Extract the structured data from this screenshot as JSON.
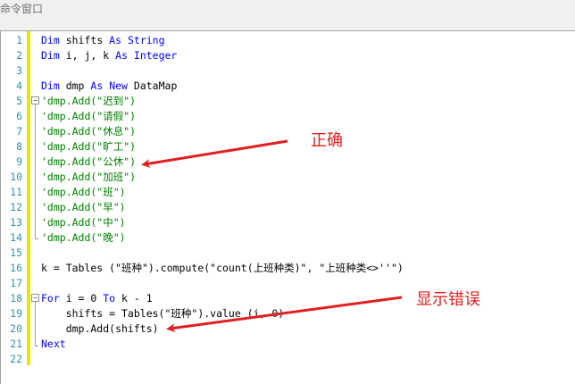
{
  "window": {
    "title": "命令窗口"
  },
  "code": {
    "lines": [
      {
        "num": "1",
        "segments": [
          {
            "t": "Dim",
            "c": "kw"
          },
          {
            "t": " shifts ",
            "c": ""
          },
          {
            "t": "As",
            "c": "kw"
          },
          {
            "t": " ",
            "c": ""
          },
          {
            "t": "String",
            "c": "kw"
          }
        ]
      },
      {
        "num": "2",
        "segments": [
          {
            "t": "Dim",
            "c": "kw"
          },
          {
            "t": " i, j, k ",
            "c": ""
          },
          {
            "t": "As",
            "c": "kw"
          },
          {
            "t": " ",
            "c": ""
          },
          {
            "t": "Integer",
            "c": "kw"
          }
        ]
      },
      {
        "num": "3",
        "segments": []
      },
      {
        "num": "4",
        "segments": [
          {
            "t": "Dim",
            "c": "kw"
          },
          {
            "t": " dmp ",
            "c": ""
          },
          {
            "t": "As",
            "c": "kw"
          },
          {
            "t": " ",
            "c": ""
          },
          {
            "t": "New",
            "c": "kw"
          },
          {
            "t": " DataMap",
            "c": ""
          }
        ]
      },
      {
        "num": "5",
        "segments": [
          {
            "t": "'dmp.Add(\"迟到\")",
            "c": "cm"
          }
        ]
      },
      {
        "num": "6",
        "segments": [
          {
            "t": "'dmp.Add(\"请假\")",
            "c": "cm"
          }
        ]
      },
      {
        "num": "7",
        "segments": [
          {
            "t": "'dmp.Add(\"休息\")",
            "c": "cm"
          }
        ]
      },
      {
        "num": "8",
        "segments": [
          {
            "t": "'dmp.Add(\"旷工\")",
            "c": "cm"
          }
        ]
      },
      {
        "num": "9",
        "segments": [
          {
            "t": "'dmp.Add(\"公休\")",
            "c": "cm"
          }
        ]
      },
      {
        "num": "10",
        "segments": [
          {
            "t": "'dmp.Add(\"加班\")",
            "c": "cm"
          }
        ]
      },
      {
        "num": "11",
        "segments": [
          {
            "t": "'dmp.Add(\"班\")",
            "c": "cm"
          }
        ]
      },
      {
        "num": "12",
        "segments": [
          {
            "t": "'dmp.Add(\"早\")",
            "c": "cm"
          }
        ]
      },
      {
        "num": "13",
        "segments": [
          {
            "t": "'dmp.Add(\"中\")",
            "c": "cm"
          }
        ]
      },
      {
        "num": "14",
        "segments": [
          {
            "t": "'dmp.Add(\"晚\")",
            "c": "cm"
          }
        ]
      },
      {
        "num": "15",
        "segments": []
      },
      {
        "num": "16",
        "segments": [
          {
            "t": "k = Tables (\"班种\").compute(\"count(上班种类)\", \"上班种类<>''\")",
            "c": ""
          }
        ]
      },
      {
        "num": "17",
        "segments": []
      },
      {
        "num": "18",
        "segments": [
          {
            "t": "For",
            "c": "kw"
          },
          {
            "t": " i = 0 ",
            "c": ""
          },
          {
            "t": "To",
            "c": "kw"
          },
          {
            "t": " k - 1",
            "c": ""
          }
        ]
      },
      {
        "num": "19",
        "segments": [
          {
            "t": "    shifts = Tables(\"班种\").value (i, 0)",
            "c": ""
          }
        ]
      },
      {
        "num": "20",
        "segments": [
          {
            "t": "    dmp.Add(shifts)",
            "c": ""
          }
        ]
      },
      {
        "num": "21",
        "segments": [
          {
            "t": "Next",
            "c": "kw"
          }
        ]
      },
      {
        "num": "22",
        "segments": []
      }
    ]
  },
  "annotations": {
    "correct": "正确",
    "error": "显示错误",
    "color": "#e02020"
  }
}
